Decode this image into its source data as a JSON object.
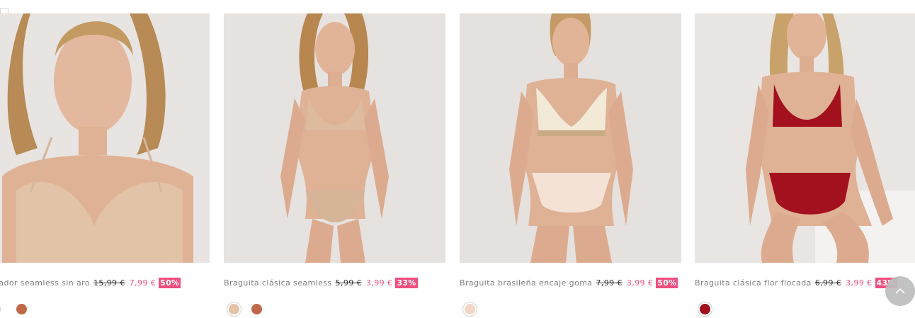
{
  "products": [
    {
      "name": "jetador seamless sin aro",
      "old_price": "15,99 €",
      "new_price": "7,99 €",
      "discount": "50%",
      "swatches": [
        "#e8cdb6",
        "#c0684a"
      ],
      "image": "model-nude-seamless-bra-closeup"
    },
    {
      "name": "Braguita clásica seamless",
      "old_price": "5,99 €",
      "new_price": "3,99 €",
      "discount": "33%",
      "swatches": [
        "#e3c4a9",
        "#c0684a"
      ],
      "image": "model-nude-seamless-set"
    },
    {
      "name": "Braguita brasileña encaje goma",
      "old_price": "7,99 €",
      "new_price": "3,99 €",
      "discount": "50%",
      "swatches": [
        "#efd6c6"
      ],
      "image": "model-cream-lace-set"
    },
    {
      "name": "Braguita clásica flor flocada",
      "old_price": "6,99 €",
      "new_price": "3,99 €",
      "discount": "43%",
      "swatches": [
        "#a0101e"
      ],
      "image": "model-red-lace-set"
    }
  ],
  "ui": {
    "scroll_top_icon": "chevron-up-icon",
    "accent_color": "#ef4f7e"
  }
}
